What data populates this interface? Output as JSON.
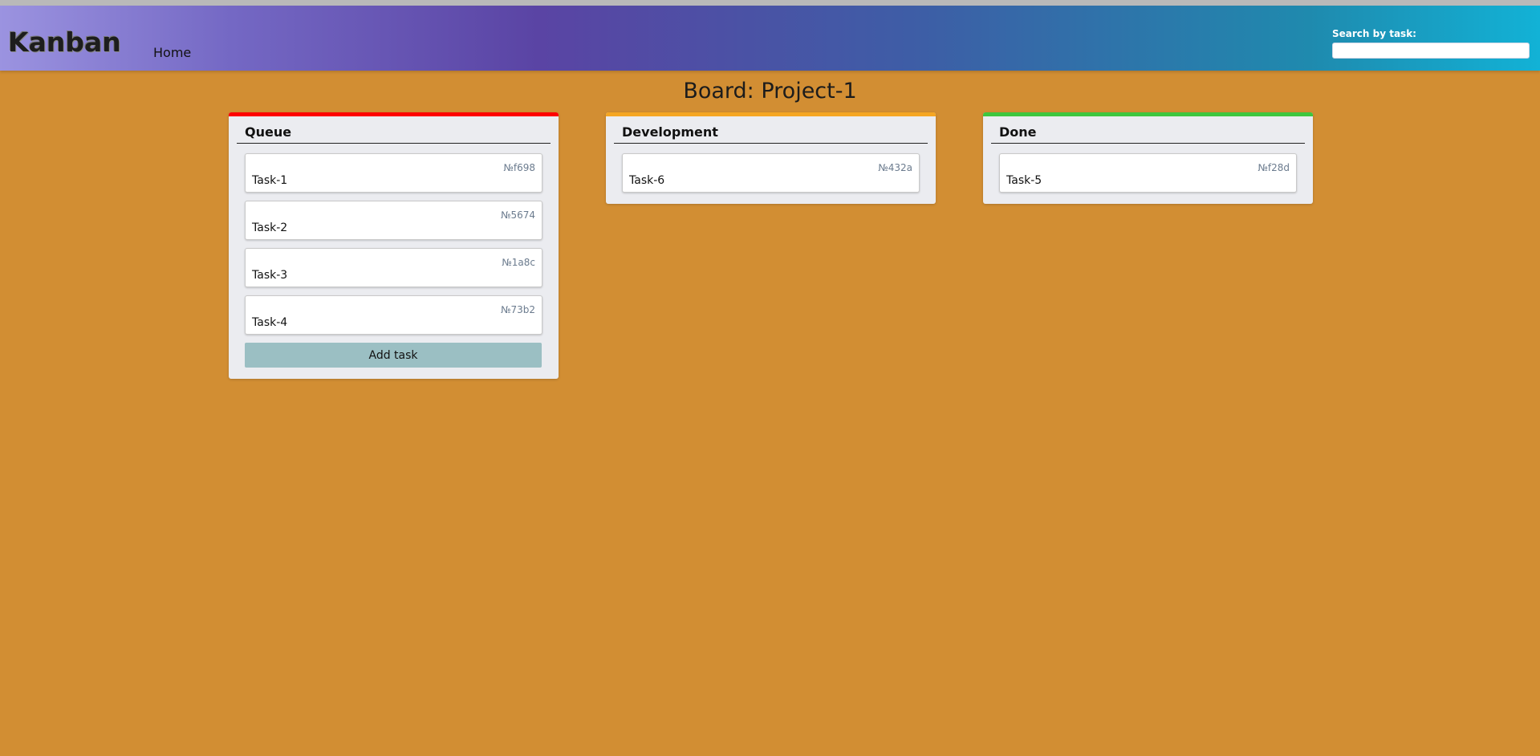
{
  "header": {
    "logo": "Kanban",
    "nav_home": "Home",
    "search_label": "Search by task:",
    "search_value": ""
  },
  "board": {
    "title": "Board: Project-1"
  },
  "columns": [
    {
      "name": "Queue",
      "accent": "#ff0000",
      "tasks": [
        {
          "id": "№f698",
          "title": "Task-1"
        },
        {
          "id": "№5674",
          "title": "Task-2"
        },
        {
          "id": "№1a8c",
          "title": "Task-3"
        },
        {
          "id": "№73b2",
          "title": "Task-4"
        }
      ],
      "add_label": "Add task"
    },
    {
      "name": "Development",
      "accent": "#f5a623",
      "tasks": [
        {
          "id": "№432a",
          "title": "Task-6"
        }
      ]
    },
    {
      "name": "Done",
      "accent": "#3ec63e",
      "tasks": [
        {
          "id": "№f28d",
          "title": "Task-5"
        }
      ]
    }
  ]
}
